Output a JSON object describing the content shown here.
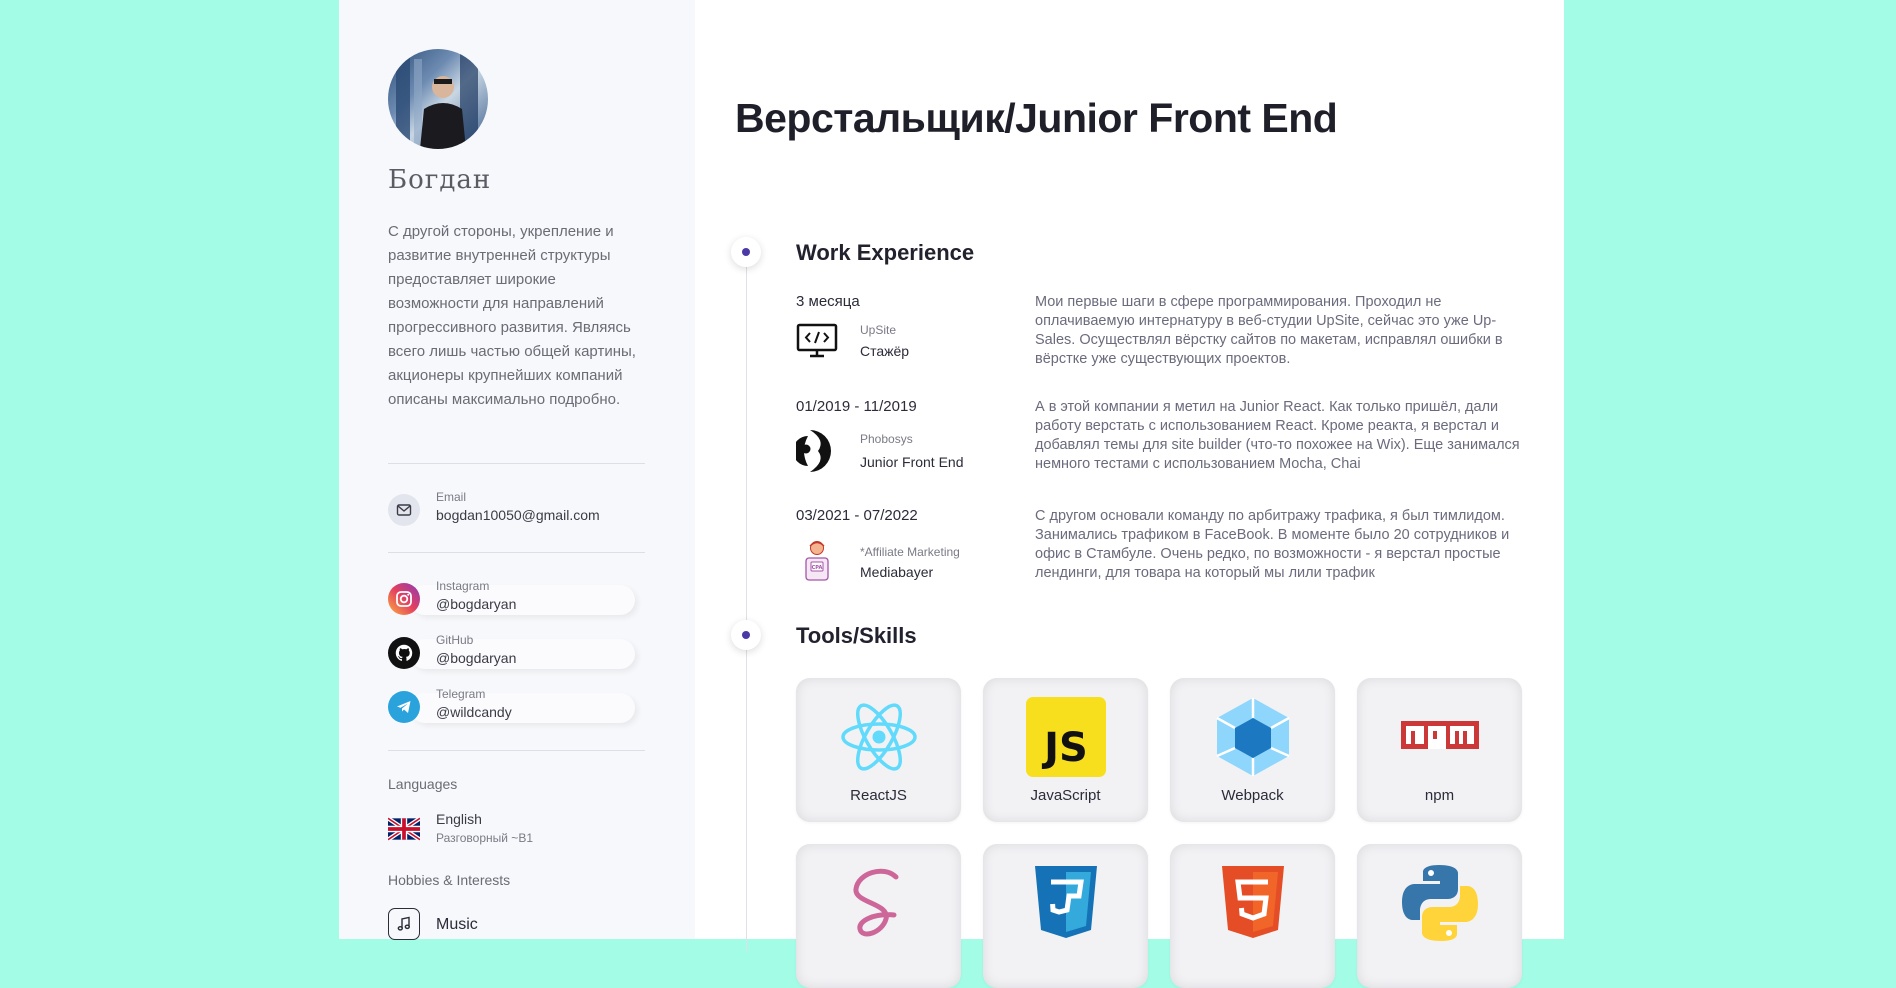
{
  "colors": {
    "background": "#a3fde6",
    "sidebar_bg": "#f7f8fb",
    "accent_dot": "#4b3aa6"
  },
  "profile": {
    "name": "Богдан",
    "bio": "С другой стороны, укрепление и развитие внутренней структуры предоставляет широкие возможности для направлений прогрессивного развития. Являясь всего лишь частью общей картины, акционеры крупнейших компаний описаны максимально подробно."
  },
  "contacts": {
    "email": {
      "label": "Email",
      "value": "bogdan10050@gmail.com",
      "icon": "mail-icon"
    }
  },
  "socials": [
    {
      "label": "Instagram",
      "value": "@bogdaryan",
      "icon": "instagram-icon",
      "color": "#e4405f"
    },
    {
      "label": "GitHub",
      "value": "@bogdaryan",
      "icon": "github-icon",
      "color": "#111111"
    },
    {
      "label": "Telegram",
      "value": "@wildcandy",
      "icon": "telegram-icon",
      "color": "#2aa3dd"
    }
  ],
  "languages": {
    "heading": "Languages",
    "items": [
      {
        "name": "English",
        "level": "Разговорный ~B1",
        "icon": "uk-flag-icon"
      }
    ]
  },
  "hobbies": {
    "heading": "Hobbies & Interests",
    "items": [
      {
        "name": "Music",
        "icon": "music-note-icon"
      }
    ]
  },
  "main": {
    "title": "Верстальщик/Junior Front End",
    "experience_title": "Work Experience",
    "skills_title": "Tools/Skills"
  },
  "jobs": [
    {
      "period": "3 месяца",
      "company": "UpSite",
      "role": "Стажёр",
      "icon": "code-monitor-icon",
      "description": "Мои первые шаги в сфере программирования. Проходил не оплачиваемую интернатуру в веб-студии UpSite, сейчас это уже Up-Sales. Осуществлял вёрстку сайтов по макетам, исправлял ошибки в вёрстке уже существующих проектов."
    },
    {
      "period": "01/2019 - 11/2019",
      "company": "Phobosys",
      "role": "Junior Front End",
      "icon": "phobosys-logo-icon",
      "description": "А в этой компании я метил на Junior React. Как только пришёл, дали работу верстать с использованием React. Кроме реакта, я верстал и добавлял темы для site builder (что-то похожее на Wix). Еще занимался немного тестами с использованием Mocha, Chai"
    },
    {
      "period": "03/2021 - 07/2022",
      "company": "*Affiliate Marketing",
      "role": "Mediabayer",
      "icon": "cpa-person-icon",
      "description": "С другом основали команду по арбитражу трафика, я был тимлидом. Занимались трафиком в FaceBook. В моменте было 20 сотрудников и офис в Стамбуле. Очень редко, по возможности - я верстал простые лендинги, для товара на который мы лили трафик"
    }
  ],
  "skills": [
    {
      "name": "ReactJS",
      "icon": "react-icon"
    },
    {
      "name": "JavaScript",
      "icon": "javascript-icon"
    },
    {
      "name": "Webpack",
      "icon": "webpack-icon"
    },
    {
      "name": "npm",
      "icon": "npm-icon"
    },
    {
      "name": "",
      "icon": "sass-icon"
    },
    {
      "name": "",
      "icon": "css3-icon"
    },
    {
      "name": "",
      "icon": "html5-icon"
    },
    {
      "name": "",
      "icon": "python-icon"
    }
  ]
}
